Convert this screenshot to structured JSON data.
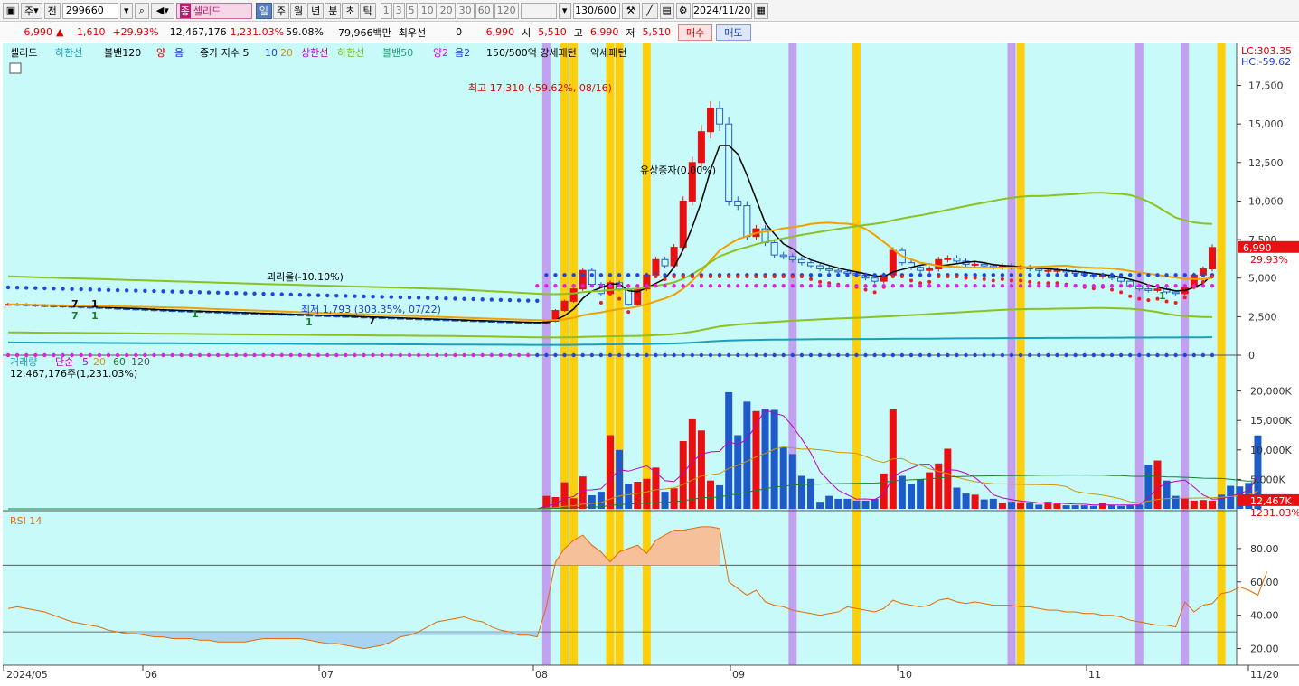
{
  "toolbar": {
    "mode_1": "주",
    "mode_2": "전",
    "code": "299660",
    "name_badge": "종",
    "name": "셀리드",
    "periods": [
      "일",
      "주",
      "월",
      "년",
      "분",
      "초",
      "틱"
    ],
    "numbers": [
      "1",
      "3",
      "5",
      "10",
      "20",
      "30",
      "60",
      "120"
    ],
    "count": "130/600",
    "date": "2024/11/20"
  },
  "quote": {
    "price": "6,990",
    "change": "1,610",
    "change_pct": "+29.93%",
    "volume": "12,467,176",
    "volume_ratio": "1,231.03%",
    "turnover_pct": "59.08%",
    "amount": "79,966백만",
    "best_label": "최우선",
    "best_value": "0",
    "best_price": "6,990",
    "open_label": "시",
    "open": "5,510",
    "high_label": "고",
    "high": "6,990",
    "low_label": "저",
    "low": "5,510",
    "buy": "매수",
    "sell": "매도"
  },
  "legend": {
    "stock": "셀리드",
    "lower": "하한선",
    "bollinger120": "볼밴120",
    "pos": "양",
    "neg": "음",
    "ma_label": "종가 지수 5",
    "ma10": "10",
    "ma20": "20",
    "upper": "상한선",
    "lower2": "하한선",
    "bollinger50": "볼밴50",
    "pos2": "양2",
    "neg2": "음2",
    "pattern1": "150/500억 강세패턴",
    "pattern2": "약세패턴"
  },
  "annotations": {
    "high": "최고 17,310 (-59.62%, 08/16)",
    "low": "최저 1,793 (303.35%, 07/22)",
    "disparity": "유상증자(0.00%)",
    "deviation": "괴리율(-10.10%)",
    "lc": "LC:303.35",
    "hc": "HC:-59.62",
    "price_tag": "6,990",
    "pct_tag": "29.93%",
    "markers": [
      "7",
      "1",
      "7",
      "1",
      "1",
      "1",
      "7",
      "1"
    ]
  },
  "price_axis": [
    "17,500",
    "15,000",
    "12,500",
    "10,000",
    "7,500",
    "5,000",
    "2,500",
    "0"
  ],
  "volume_panel": {
    "title": "거래량",
    "ma_label": "단순",
    "ma_5": "5",
    "ma_20": "20",
    "ma_60": "60",
    "ma_120": "120",
    "summary": "12,467,176주(1,231.03%)",
    "axis": [
      "20,000K",
      "15,000K",
      "10,000K",
      "5,000K"
    ],
    "tag_value": "12,467K",
    "tag_pct": "1231.03%"
  },
  "rsi_panel": {
    "title": "RSI 14",
    "axis": [
      "80.00",
      "60.00",
      "40.00",
      "20.00"
    ]
  },
  "date_axis": [
    "2024/05",
    "06",
    "07",
    "08",
    "09",
    "10",
    "11",
    "11/20"
  ],
  "colors": {
    "plot_bg": "#c8fafa",
    "up": "#e81010",
    "down": "#1f5bc8",
    "purple_band": "#c29cf0",
    "yellow_band": "#ffcc00"
  },
  "chart_data": {
    "type": "candlestick",
    "close": [
      3300,
      3280,
      3250,
      3220,
      3200,
      3190,
      3170,
      3150,
      3120,
      3100,
      3080,
      3050,
      3020,
      3000,
      2980,
      2950,
      2930,
      2900,
      2880,
      2860,
      2840,
      2820,
      2800,
      2780,
      2760,
      2740,
      2720,
      2700,
      2680,
      2660,
      2640,
      2620,
      2600,
      2580,
      2560,
      2540,
      2520,
      2500,
      2480,
      2460,
      2440,
      2420,
      2400,
      2380,
      2360,
      2340,
      2320,
      2300,
      2280,
      2260,
      2240,
      2220,
      2200,
      2180,
      2160,
      2140,
      2120,
      2100,
      2080,
      2200,
      2900,
      3500,
      4300,
      5500,
      4600,
      4000,
      4700,
      4300,
      3300,
      4300,
      5200,
      6200,
      5800,
      7000,
      10000,
      12500,
      14500,
      16000,
      15000,
      10000,
      9700,
      7700,
      8200,
      7300,
      6500,
      6400,
      6200,
      6000,
      5800,
      5600,
      5500,
      5400,
      5300,
      5200,
      5000,
      4800,
      5200,
      6800,
      6000,
      5700,
      5500,
      5600,
      6200,
      6300,
      6100,
      5900,
      5900,
      5800,
      5700,
      5800,
      5700,
      5700,
      5600,
      5500,
      5500,
      5500,
      5400,
      5300,
      5200,
      5100,
      5200,
      5000,
      4800,
      4500,
      4300,
      4200,
      4300,
      4100,
      4000,
      4400,
      5200,
      5600,
      6990
    ],
    "volume_k": [
      0,
      0,
      0,
      0,
      0,
      0,
      0,
      0,
      0,
      0,
      0,
      0,
      0,
      0,
      0,
      0,
      0,
      0,
      0,
      0,
      0,
      0,
      0,
      0,
      0,
      0,
      0,
      0,
      0,
      0,
      0,
      0,
      0,
      0,
      0,
      0,
      0,
      0,
      0,
      0,
      0,
      0,
      0,
      0,
      0,
      0,
      0,
      0,
      0,
      0,
      0,
      0,
      0,
      0,
      0,
      0,
      0,
      0,
      0,
      2200,
      2000,
      4500,
      1800,
      5500,
      2300,
      2900,
      12500,
      10000,
      4300,
      4600,
      5100,
      7000,
      2900,
      3500,
      11500,
      15200,
      13300,
      4800,
      4000,
      19800,
      12500,
      18200,
      16600,
      17000,
      16800,
      10500,
      9300,
      5600,
      5100,
      1200,
      2200,
      1700,
      1700,
      1400,
      1400,
      1700,
      6000,
      16900,
      5600,
      4200,
      5000,
      6200,
      7700,
      10200,
      3600,
      2600,
      2400,
      1600,
      1700,
      1000,
      1200,
      1100,
      1000,
      700,
      1200,
      900,
      600,
      600,
      600,
      500,
      1000,
      600,
      500,
      600,
      700,
      7500,
      8200,
      4800,
      2200,
      1800,
      1400,
      1500,
      1400,
      2400,
      3900,
      3800,
      4400,
      12467
    ],
    "rsi": [
      44,
      45,
      44,
      43,
      42,
      40,
      38,
      36,
      35,
      34,
      33,
      31,
      30,
      29,
      29,
      28,
      27,
      27,
      26,
      26,
      26,
      25,
      25,
      24,
      24,
      24,
      24,
      25,
      26,
      26,
      26,
      26,
      26,
      25,
      24,
      23,
      23,
      22,
      21,
      20,
      21,
      22,
      24,
      27,
      28,
      30,
      33,
      36,
      37,
      38,
      39,
      37,
      36,
      33,
      31,
      30,
      28,
      28,
      27,
      45,
      72,
      80,
      85,
      88,
      82,
      78,
      72,
      78,
      80,
      82,
      77,
      85,
      88,
      91,
      91,
      92,
      93,
      93,
      92,
      60,
      56,
      52,
      55,
      48,
      46,
      45,
      43,
      42,
      41,
      40,
      41,
      42,
      45,
      44,
      43,
      42,
      44,
      49,
      47,
      46,
      45,
      46,
      49,
      50,
      48,
      47,
      48,
      47,
      46,
      46,
      46,
      45,
      45,
      44,
      43,
      43,
      42,
      42,
      41,
      41,
      40,
      40,
      39,
      37,
      36,
      35,
      34,
      34,
      33,
      48,
      42,
      46,
      47,
      53,
      54,
      57,
      55,
      52,
      66
    ],
    "x": [
      "2024/05",
      "06",
      "07",
      "08",
      "09",
      "10",
      "11",
      "11/20"
    ],
    "series": [
      {
        "name": "거래량",
        "values": "volume_k"
      },
      {
        "name": "RSI 14",
        "values": "rsi"
      }
    ],
    "ylim_price": [
      0,
      18000
    ],
    "ylim_volume_k": [
      0,
      25000
    ],
    "ylim_rsi": [
      10,
      100
    ],
    "rsi_levels": [
      70,
      30
    ]
  }
}
